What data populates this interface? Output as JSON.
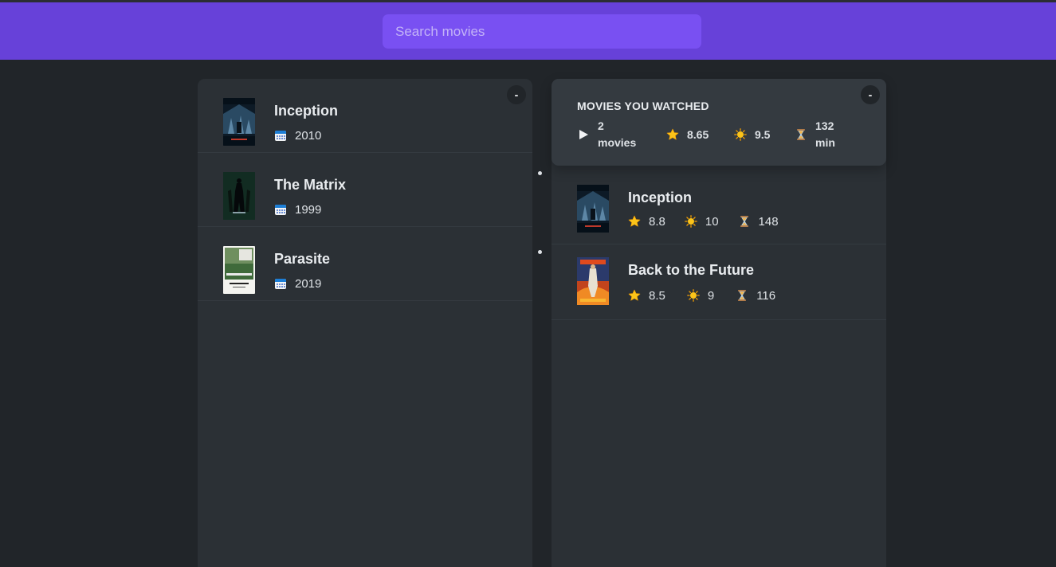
{
  "search": {
    "placeholder": "Search movies"
  },
  "results": {
    "toggle_label": "-",
    "movies": [
      {
        "title": "Inception",
        "year": "2010"
      },
      {
        "title": "The Matrix",
        "year": "1999"
      },
      {
        "title": "Parasite",
        "year": "2019"
      }
    ]
  },
  "watched": {
    "toggle_label": "-",
    "summary": {
      "title": "MOVIES YOU WATCHED",
      "count": "2\nmovies",
      "imdb_avg": "8.65",
      "user_avg": "9.5",
      "runtime_avg": "132\nmin"
    },
    "movies": [
      {
        "title": "Inception",
        "imdb": "8.8",
        "user": "10",
        "runtime": "148"
      },
      {
        "title": "Back to the Future",
        "imdb": "8.5",
        "user": "9",
        "runtime": "116"
      }
    ]
  },
  "icons": {
    "calendar": "calendar-icon",
    "play": "play-icon",
    "star": "star-icon",
    "sun": "glowing-star-icon",
    "hourglass": "hourglass-icon"
  },
  "colors": {
    "navbar": "#6741d9",
    "search_bg": "#7950f2",
    "background": "#212529",
    "box": "#2b3035",
    "summary": "#343a40",
    "star": "#fcc419"
  }
}
